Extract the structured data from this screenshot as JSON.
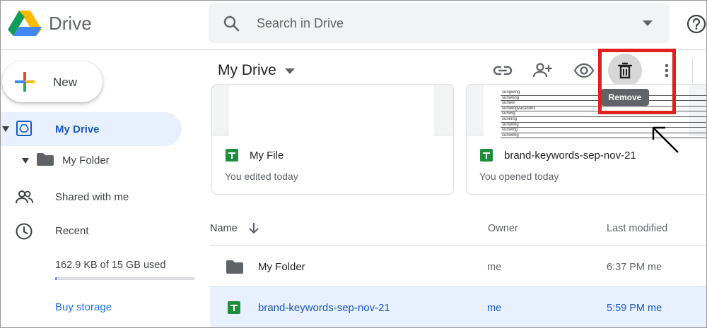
{
  "header": {
    "brand": "Drive",
    "search_placeholder": "Search in Drive"
  },
  "sidebar": {
    "new_label": "New",
    "my_drive": "My Drive",
    "my_folder": "My Folder",
    "shared": "Shared with me",
    "recent": "Recent",
    "storage_text": "162.9 KB of 15 GB used",
    "storage_used_fraction": 0.01,
    "buy_storage": "Buy storage"
  },
  "toolbar": {
    "title": "My Drive",
    "tooltip_remove": "Remove"
  },
  "cards": [
    {
      "name": "My File",
      "subtitle": "You edited today"
    },
    {
      "name": "brand-keywords-sep-nov-21",
      "subtitle": "You opened today",
      "preview_rows": [
        "sungwing",
        "sunwong",
        "sunwin",
        "sunwingvacations",
        "sunwig",
        "suneing",
        "sunwimg",
        "sunwing",
        "sunwimg"
      ]
    }
  ],
  "table": {
    "col_name": "Name",
    "col_owner": "Owner",
    "col_modified": "Last modified",
    "rows": [
      {
        "name": "My Folder",
        "owner": "me",
        "modified": "6:37 PM",
        "modified_by": "me"
      },
      {
        "name": "brand-keywords-sep-nov-21",
        "owner": "me",
        "modified": "5:59 PM",
        "modified_by": "me"
      }
    ]
  },
  "colors": {
    "accent": "#1a73e8",
    "selected_bg": "#e8f0fe",
    "annotation_red": "#e0201f"
  }
}
